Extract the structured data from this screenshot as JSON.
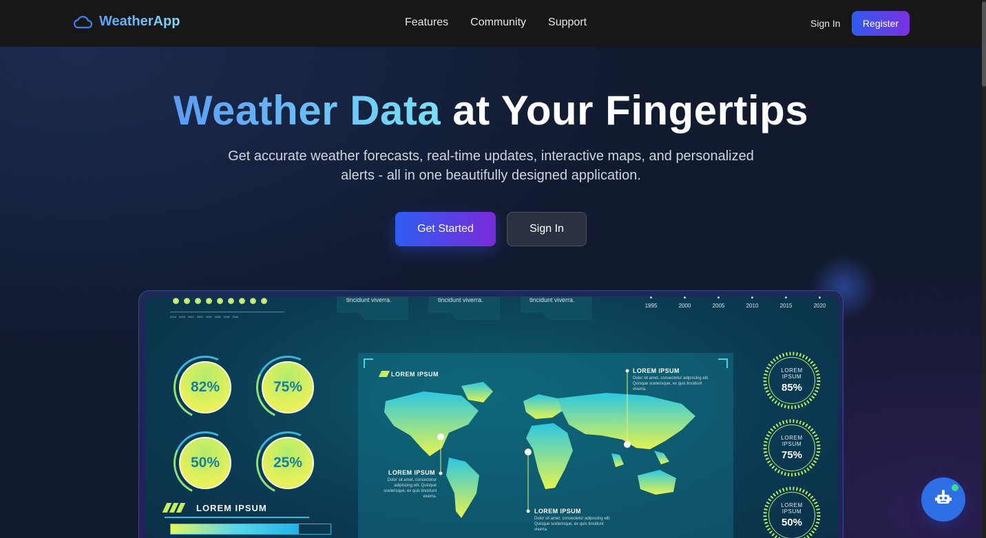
{
  "navbar": {
    "brand": "WeatherApp",
    "links": [
      "Features",
      "Community",
      "Support"
    ],
    "sign_in": "Sign In",
    "register": "Register"
  },
  "hero": {
    "title_accent": "Weather Data",
    "title_rest": " at Your Fingertips",
    "subtitle_line1": "Get accurate weather forecasts, real-time updates, interactive maps, and personalized",
    "subtitle_line2": "alerts - all in one beautifully designed application.",
    "primary_button": "Get Started",
    "secondary_button": "Sign In"
  },
  "preview": {
    "mini_years": [
      "2010",
      "2015",
      "2020",
      "2025",
      "2030",
      "2035",
      "2040",
      "2045"
    ],
    "tabs": [
      "tincidunt viverra.",
      "tincidunt viverra.",
      "tincidunt viverra."
    ],
    "years": [
      "1995",
      "2000",
      "2005",
      "2010",
      "2015",
      "2020"
    ],
    "gauges": [
      "82%",
      "75%",
      "50%",
      "25%"
    ],
    "banner": "LOREM IPSUM",
    "progress_fraction": 0.8,
    "map": {
      "title": "LOREM IPSUM",
      "labels": [
        {
          "title": "LOREM IPSUM",
          "desc": "Dolor sit amet, consectetur adipiscing elit. Quisque scelerisque, ex quis tincidunt viverra."
        },
        {
          "title": "LOREM IPSUM",
          "desc": "Dolor sit amet, consectetur adipiscing elit. Quisque scelerisque, ex quis tincidunt viverra."
        },
        {
          "title": "LOREM IPSUM",
          "desc": "Dolor sit amet, consectetur adipiscing elit. Quisque scelerisque, ex quis tincidunt viverra."
        }
      ]
    },
    "rings": [
      {
        "label1": "LOREM",
        "label2": "IPSUM",
        "value": "85%"
      },
      {
        "label1": "LOREM",
        "label2": "IPSUM",
        "value": "75%"
      },
      {
        "label1": "LOREM",
        "label2": "IPSUM",
        "value": "50%"
      }
    ]
  },
  "colors": {
    "accent_start": "#2f5cf0",
    "accent_end": "#7b2fe0",
    "brand_gradient_start": "#5aa2f7",
    "brand_gradient_end": "#7fdcf4",
    "chatbot": "#2f6fe6"
  },
  "icons": {
    "brand": "cloud-icon",
    "chatbot": "robot-icon"
  }
}
